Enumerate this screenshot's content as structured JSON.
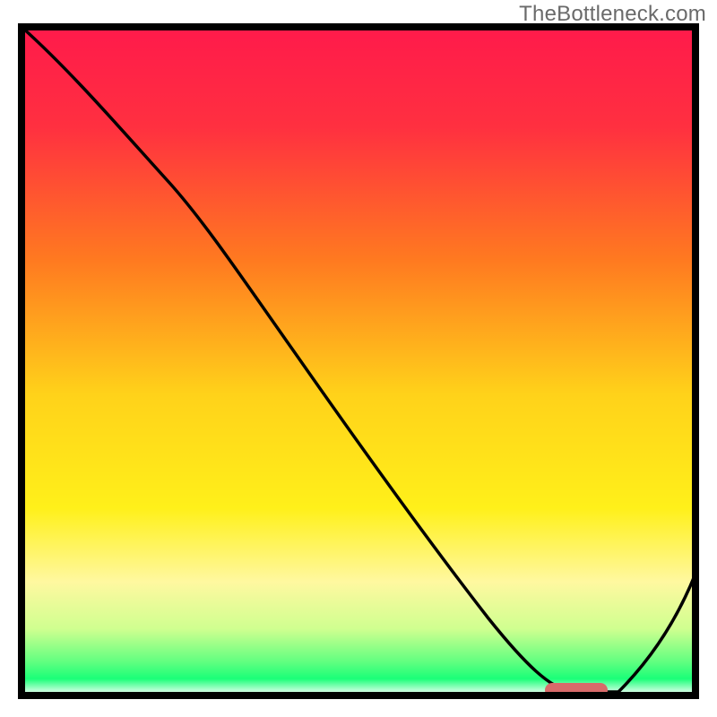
{
  "watermark": "TheBottleneck.com",
  "colors": {
    "red": "#ff1a4b",
    "orange": "#ff8c1a",
    "yellow": "#ffe81a",
    "pale_yellow": "#fffab0",
    "green": "#1aff78",
    "white": "#ffffff",
    "black": "#000000",
    "marker": "#d96a6a",
    "frame": "#000000"
  },
  "chart_data": {
    "type": "line",
    "title": "",
    "xlabel": "",
    "ylabel": "",
    "xlim": [
      0,
      100
    ],
    "ylim": [
      0,
      100
    ],
    "x": [
      0,
      10,
      22,
      30,
      40,
      50,
      60,
      68,
      75,
      80,
      85,
      88,
      100
    ],
    "values": [
      100,
      93,
      80,
      70,
      57,
      43,
      30,
      17,
      6,
      1,
      0,
      0,
      18
    ],
    "marker": {
      "x_start": 78,
      "x_end": 86,
      "y": 1.5,
      "color": "#d96a6a"
    },
    "gradient_stops": [
      {
        "offset": 0.0,
        "color": "#ff1a4b"
      },
      {
        "offset": 0.15,
        "color": "#ff3040"
      },
      {
        "offset": 0.35,
        "color": "#ff7a20"
      },
      {
        "offset": 0.55,
        "color": "#ffd21a"
      },
      {
        "offset": 0.72,
        "color": "#fff01a"
      },
      {
        "offset": 0.83,
        "color": "#fff8a0"
      },
      {
        "offset": 0.9,
        "color": "#d0ff90"
      },
      {
        "offset": 0.95,
        "color": "#60ff80"
      },
      {
        "offset": 0.975,
        "color": "#1aff78"
      },
      {
        "offset": 1.0,
        "color": "#ffffff"
      }
    ],
    "frame": true
  }
}
